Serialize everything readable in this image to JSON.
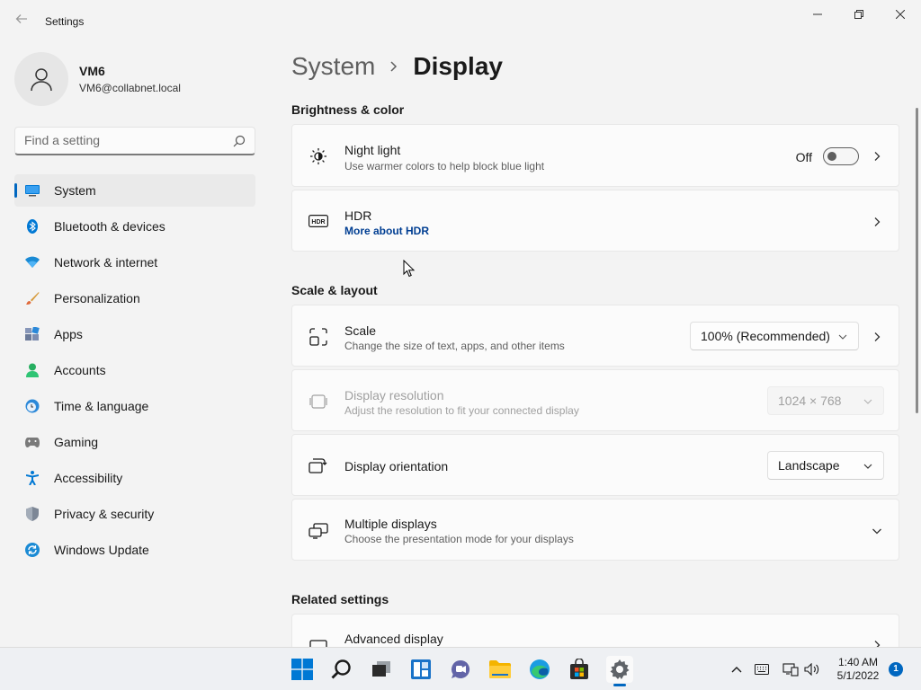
{
  "window": {
    "title": "Settings",
    "back_icon": "back-arrow-icon",
    "minimize_icon": "minimize-icon",
    "maximize_icon": "restore-icon",
    "close_icon": "close-icon"
  },
  "profile": {
    "name": "VM6",
    "email": "VM6@collabnet.local"
  },
  "search": {
    "placeholder": "Find a setting"
  },
  "sidebar": {
    "items": [
      {
        "label": "System",
        "icon": "system-icon",
        "active": true
      },
      {
        "label": "Bluetooth & devices",
        "icon": "bluetooth-icon"
      },
      {
        "label": "Network & internet",
        "icon": "wifi-icon"
      },
      {
        "label": "Personalization",
        "icon": "brush-icon"
      },
      {
        "label": "Apps",
        "icon": "apps-icon"
      },
      {
        "label": "Accounts",
        "icon": "accounts-icon"
      },
      {
        "label": "Time & language",
        "icon": "clock-globe-icon"
      },
      {
        "label": "Gaming",
        "icon": "gamepad-icon"
      },
      {
        "label": "Accessibility",
        "icon": "accessibility-icon"
      },
      {
        "label": "Privacy & security",
        "icon": "shield-icon"
      },
      {
        "label": "Windows Update",
        "icon": "update-icon"
      }
    ]
  },
  "main": {
    "breadcrumb": {
      "parent": "System",
      "current": "Display"
    },
    "sections": {
      "brightness": "Brightness & color",
      "scale_layout": "Scale & layout",
      "related": "Related settings"
    },
    "night_light": {
      "title": "Night light",
      "subtitle": "Use warmer colors to help block blue light",
      "toggle_state": "Off"
    },
    "hdr": {
      "title": "HDR",
      "link": "More about HDR"
    },
    "scale": {
      "title": "Scale",
      "subtitle": "Change the size of text, apps, and other items",
      "value": "100% (Recommended)"
    },
    "resolution": {
      "title": "Display resolution",
      "subtitle": "Adjust the resolution to fit your connected display",
      "value": "1024 × 768"
    },
    "orientation": {
      "title": "Display orientation",
      "value": "Landscape"
    },
    "multiple": {
      "title": "Multiple displays",
      "subtitle": "Choose the presentation mode for your displays"
    },
    "advanced": {
      "title": "Advanced display"
    }
  },
  "taskbar": {
    "time": "1:40 AM",
    "date": "5/1/2022",
    "notifications": "1",
    "accent": "#0067c0"
  }
}
